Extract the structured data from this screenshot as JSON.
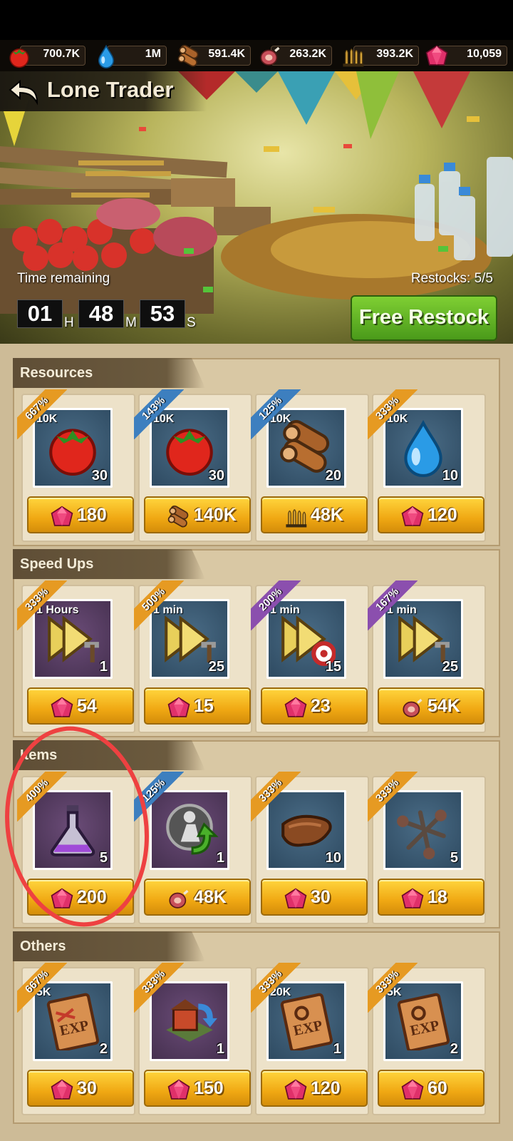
{
  "resources_bar": [
    {
      "icon": "tomato-icon",
      "value": "700.7K"
    },
    {
      "icon": "water-drop-icon",
      "value": "1M"
    },
    {
      "icon": "wood-logs-icon",
      "value": "591.4K"
    },
    {
      "icon": "meat-icon",
      "value": "263.2K"
    },
    {
      "icon": "bullets-icon",
      "value": "393.2K"
    },
    {
      "icon": "gem-icon",
      "value": "10,059"
    }
  ],
  "header": {
    "title": "Lone Trader"
  },
  "timer": {
    "label": "Time remaining",
    "hours": "01",
    "hours_unit": "H",
    "minutes": "48",
    "minutes_unit": "M",
    "seconds": "53",
    "seconds_unit": "S"
  },
  "restock": {
    "label": "Restocks: 5/5",
    "button": "Free Restock"
  },
  "sections": [
    {
      "title": "Resources",
      "items": [
        {
          "ribbon": "667%",
          "ribbon_color": "#e69a22",
          "tag": "10K",
          "icon": "tomato-icon",
          "bg": "blue",
          "qty": "30",
          "currency": "gem-icon",
          "price": "180"
        },
        {
          "ribbon": "143%",
          "ribbon_color": "#3d7fbf",
          "tag": "10K",
          "icon": "tomato-icon",
          "bg": "blue",
          "qty": "30",
          "currency": "wood-logs-icon",
          "price": "140K"
        },
        {
          "ribbon": "125%",
          "ribbon_color": "#3d7fbf",
          "tag": "10K",
          "icon": "wood-logs-icon",
          "bg": "blue",
          "qty": "20",
          "currency": "bullets-icon",
          "price": "48K"
        },
        {
          "ribbon": "333%",
          "ribbon_color": "#e69a22",
          "tag": "10K",
          "icon": "water-drop-icon",
          "bg": "blue",
          "qty": "10",
          "currency": "gem-icon",
          "price": "120"
        }
      ]
    },
    {
      "title": "Speed Ups",
      "items": [
        {
          "ribbon": "333%",
          "ribbon_color": "#e69a22",
          "tag": "1 Hours",
          "icon": "speedup-hammer-icon",
          "bg": "purple",
          "qty": "1",
          "currency": "gem-icon",
          "price": "54"
        },
        {
          "ribbon": "500%",
          "ribbon_color": "#e69a22",
          "tag": "1 min",
          "icon": "speedup-hammer-icon",
          "bg": "blue",
          "qty": "25",
          "currency": "gem-icon",
          "price": "15"
        },
        {
          "ribbon": "200%",
          "ribbon_color": "#8b4fae",
          "tag": "1 min",
          "icon": "speedup-target-icon",
          "bg": "blue",
          "qty": "15",
          "currency": "gem-icon",
          "price": "23"
        },
        {
          "ribbon": "167%",
          "ribbon_color": "#8b4fae",
          "tag": "1 min",
          "icon": "speedup-hammer-icon",
          "bg": "blue",
          "qty": "25",
          "currency": "meat-icon",
          "price": "54K"
        }
      ]
    },
    {
      "title": "Items",
      "items": [
        {
          "ribbon": "400%",
          "ribbon_color": "#e69a22",
          "tag": "",
          "icon": "potion-flask-icon",
          "bg": "purple",
          "qty": "5",
          "currency": "gem-icon",
          "price": "200"
        },
        {
          "ribbon": "125%",
          "ribbon_color": "#3d7fbf",
          "tag": "",
          "icon": "survivor-return-icon",
          "bg": "purple",
          "qty": "1",
          "currency": "meat-icon",
          "price": "48K"
        },
        {
          "ribbon": "333%",
          "ribbon_color": "#e69a22",
          "tag": "",
          "icon": "leather-icon",
          "bg": "blue",
          "qty": "10",
          "currency": "gem-icon",
          "price": "30"
        },
        {
          "ribbon": "333%",
          "ribbon_color": "#e69a22",
          "tag": "",
          "icon": "nails-icon",
          "bg": "blue",
          "qty": "5",
          "currency": "gem-icon",
          "price": "18"
        }
      ]
    },
    {
      "title": "Others",
      "items": [
        {
          "ribbon": "667%",
          "ribbon_color": "#e69a22",
          "tag": "5K",
          "icon": "exp-book-combat-icon",
          "bg": "blue",
          "qty": "2",
          "currency": "gem-icon",
          "price": "30"
        },
        {
          "ribbon": "333%",
          "ribbon_color": "#e69a22",
          "tag": "",
          "icon": "relocate-building-icon",
          "bg": "purple",
          "qty": "1",
          "currency": "gem-icon",
          "price": "150"
        },
        {
          "ribbon": "333%",
          "ribbon_color": "#e69a22",
          "tag": "20K",
          "icon": "exp-book-develop-icon",
          "bg": "blue",
          "qty": "1",
          "currency": "gem-icon",
          "price": "120"
        },
        {
          "ribbon": "333%",
          "ribbon_color": "#e69a22",
          "tag": "5K",
          "icon": "exp-book-develop-icon",
          "bg": "blue",
          "qty": "2",
          "currency": "gem-icon",
          "price": "60"
        }
      ]
    }
  ],
  "annotation": {
    "color": "#ee4141"
  }
}
